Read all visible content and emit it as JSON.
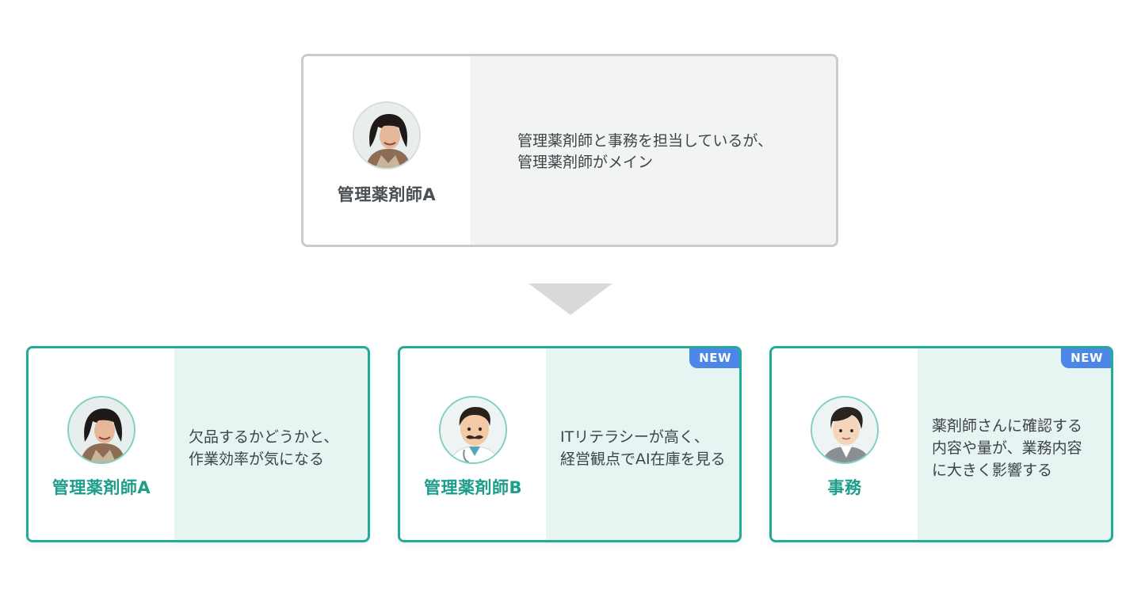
{
  "top": {
    "name": "管理薬剤師A",
    "description_lines": [
      "管理薬剤師と事務を担当しているが、",
      "管理薬剤師がメイン"
    ],
    "avatar_icon": "woman-photo-icon"
  },
  "cards": [
    {
      "name": "管理薬剤師A",
      "description_lines": [
        "欠品するかどうかと、",
        "作業効率が気になる"
      ],
      "badge": "",
      "avatar_icon": "woman-photo-icon"
    },
    {
      "name": "管理薬剤師B",
      "description_lines": [
        "ITリテラシーが高く、",
        "経営観点でAI在庫を見る"
      ],
      "badge": "NEW",
      "avatar_icon": "man-doctor-icon"
    },
    {
      "name": "事務",
      "description_lines": [
        "薬剤師さんに確認する",
        "内容や量が、業務内容",
        "に大きく影響する"
      ],
      "badge": "NEW",
      "avatar_icon": "office-worker-icon"
    }
  ],
  "colors": {
    "accent": "#22ab98",
    "badge": "#4c86e6",
    "top_border": "#c9ccce",
    "arrow": "#d8dadc"
  }
}
